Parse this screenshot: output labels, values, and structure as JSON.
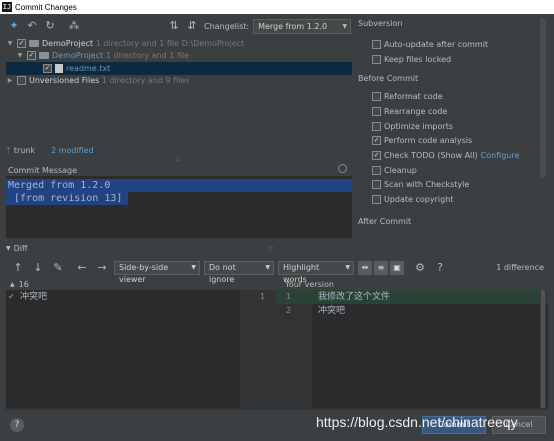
{
  "window": {
    "title": "Commit Changes",
    "app_icon": "IJ"
  },
  "toolbar": {
    "icons": [
      "move-icon",
      "rollback-icon",
      "refresh-icon",
      "group-by-icon",
      "expand-all-icon",
      "collapse-all-icon"
    ],
    "changelist_label": "Changelist:",
    "changelist_value": "Merge from 1.2.0"
  },
  "tree": {
    "root": {
      "name": "DemoProject",
      "meta": "1 directory and 1 file",
      "path": "D:\\DemoProject"
    },
    "child": {
      "name": "DemoProject",
      "meta": "1 directory and 1 file"
    },
    "file": {
      "name": "readme.txt"
    },
    "unversioned": {
      "name": "Unversioned Files",
      "meta": "1 directory and 9 files"
    }
  },
  "status": {
    "branch": "trunk",
    "modified": "2 modified"
  },
  "commit_message": {
    "label": "Commit Message",
    "lines": [
      "Merged from 1.2.0",
      " [from revision 13]"
    ]
  },
  "subversion": {
    "header": "Subversion",
    "options": [
      {
        "label": "Auto-update after commit",
        "checked": false
      },
      {
        "label": "Keep files locked",
        "checked": false
      }
    ]
  },
  "before_commit": {
    "header": "Before Commit",
    "options": [
      {
        "label": "Reformat code",
        "checked": false
      },
      {
        "label": "Rearrange code",
        "checked": false
      },
      {
        "label": "Optimize imports",
        "checked": false
      },
      {
        "label": "Perform code analysis",
        "checked": true
      },
      {
        "label": "Check TODO (Show All)",
        "checked": true,
        "link": "Configure"
      },
      {
        "label": "Cleanup",
        "checked": false
      },
      {
        "label": "Scan with Checkstyle",
        "checked": false
      },
      {
        "label": "Update copyright",
        "checked": false
      }
    ]
  },
  "after_commit": {
    "header": "After Commit"
  },
  "diff": {
    "label": "Diff",
    "viewer": "Side-by-side viewer",
    "ignore": "Do not ignore",
    "highlight": "Highlight words",
    "count": "1 difference",
    "left_revision": "16",
    "right_title": "Your version",
    "left_lines": [
      "冲突吧"
    ],
    "right_lines": [
      "我修改了这个文件",
      "冲突吧"
    ],
    "left_line_numbers": [
      "1"
    ],
    "right_line_numbers": [
      "1",
      "2"
    ]
  },
  "buttons": {
    "help": "?",
    "commit": "Commit",
    "cancel": "Cancel"
  },
  "watermark": "https://blog.csdn.net/chinatreeqy",
  "colors": {
    "background": "#3c3f41",
    "editor": "#2b2b2b",
    "selection": "#214283",
    "added": "#294436",
    "link": "#5f9fd6"
  }
}
